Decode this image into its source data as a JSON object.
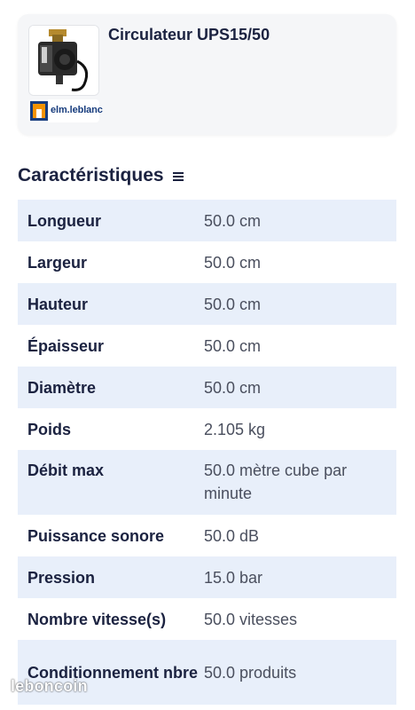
{
  "product": {
    "title": "Circulateur UPS15/50",
    "image": "circulator-pump-image",
    "brand": "elm.leblanc"
  },
  "section": {
    "title": "Caractéristiques",
    "icon": "menu-lines-icon"
  },
  "specs": [
    {
      "label": "Longueur",
      "value": "50.0 cm"
    },
    {
      "label": "Largeur",
      "value": "50.0 cm"
    },
    {
      "label": "Hauteur",
      "value": "50.0 cm"
    },
    {
      "label": "Épaisseur",
      "value": "50.0 cm"
    },
    {
      "label": "Diamètre",
      "value": "50.0 cm"
    },
    {
      "label": "Poids",
      "value": "2.105 kg"
    },
    {
      "label": "Débit max",
      "value": "50.0 mètre cube par minute"
    },
    {
      "label": "Puissance sonore",
      "value": "50.0 dB"
    },
    {
      "label": "Pression",
      "value": "15.0 bar"
    },
    {
      "label": "Nombre vitesse(s)",
      "value": "50.0 vitesses"
    },
    {
      "label": "Conditionnement nbre",
      "value": "50.0 produits"
    }
  ],
  "watermark": "leboncoin",
  "colors": {
    "text": "#1b2240",
    "value_text": "#4a4f5e",
    "row_shade": "#e8effa",
    "card_bg": "#f5f6f8",
    "brand_blue": "#173c7d",
    "brand_orange": "#f39200"
  }
}
